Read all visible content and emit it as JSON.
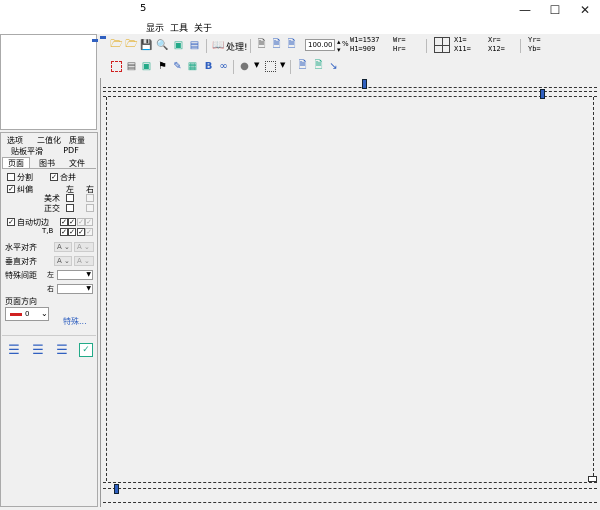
{
  "window": {
    "title": "5"
  },
  "menu": [
    "显示",
    "工具",
    "关于"
  ],
  "toolbar": {
    "process_label": "处理!",
    "zoom_value": "100.00",
    "zoom_unit": "%",
    "w1": "W1=1537",
    "h1": "H1=909",
    "wr": "Wr=",
    "hr": "Hr=",
    "x1": "X1=",
    "x11": "X11=",
    "xr": "Xr=",
    "x12": "X12=",
    "yr": "Yr=",
    "yb": "Yb="
  },
  "tabs": {
    "row1": [
      "选项",
      "二值化",
      "质量"
    ],
    "row2": [
      "贴板平滑",
      "PDF"
    ],
    "row3": [
      "页面",
      "图书",
      "文件"
    ]
  },
  "options": {
    "split": "分割",
    "merge": "合并",
    "deskew": "纠偏",
    "left": "左",
    "right": "右",
    "art": "美术",
    "orth": "正交",
    "auto_crop": "自动切边",
    "tb": "T,B",
    "h_align": "水平对齐",
    "v_align": "垂直对齐",
    "special_spacing": "特殊间距",
    "left_short": "左",
    "right_short": "右",
    "combo_char": "A",
    "page_dir": "页面方向",
    "page_dir_value": "0",
    "special_link": "特殊..."
  },
  "colors": {
    "accent": "#3060c0",
    "red": "#d02020"
  }
}
